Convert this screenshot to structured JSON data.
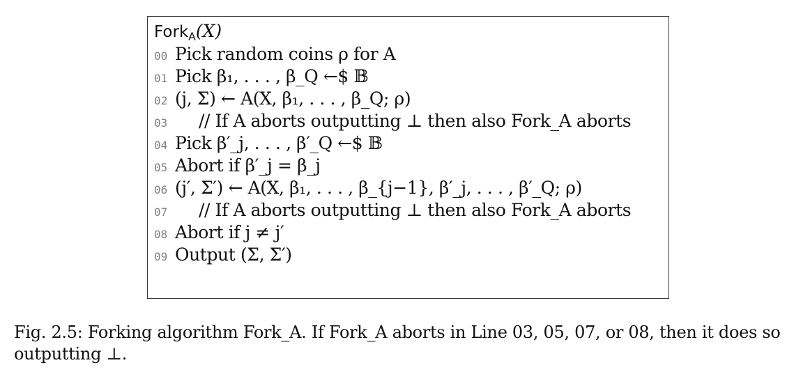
{
  "figure": {
    "algorithm": {
      "title_prefix": "Fork",
      "title_subscript": "A",
      "title_args": "(X)",
      "lines": [
        {
          "number": "00",
          "text": "Pick random coins ρ for A",
          "is_comment": false
        },
        {
          "number": "01",
          "text": "Pick β₁, . . . , β_Q ←$ 𝔹",
          "is_comment": false
        },
        {
          "number": "02",
          "text": "(j, Σ) ← A(X, β₁, . . . , β_Q; ρ)",
          "is_comment": false
        },
        {
          "number": "03",
          "text": "// If A aborts outputting ⊥ then also Fork_A aborts",
          "is_comment": true
        },
        {
          "number": "04",
          "text": "Pick β′_j, . . . , β′_Q ←$ 𝔹",
          "is_comment": false
        },
        {
          "number": "05",
          "text": "Abort if β′_j = β_j",
          "is_comment": false
        },
        {
          "number": "06",
          "text": "(j′, Σ′) ← A(X, β₁, . . . , β_{j−1}, β′_j, . . . , β′_Q; ρ)",
          "is_comment": false
        },
        {
          "number": "07",
          "text": "// If A aborts outputting ⊥ then also Fork_A aborts",
          "is_comment": true
        },
        {
          "number": "08",
          "text": "Abort if j ≠ j′",
          "is_comment": false
        },
        {
          "number": "09",
          "text": "Output (Σ, Σ′)",
          "is_comment": false
        }
      ]
    },
    "caption": {
      "label": "Fig. 2.5:",
      "text": "Forking algorithm Fork_A. If Fork_A aborts in Line 03, 05, 07, or 08, then it does so outputting ⊥."
    }
  }
}
